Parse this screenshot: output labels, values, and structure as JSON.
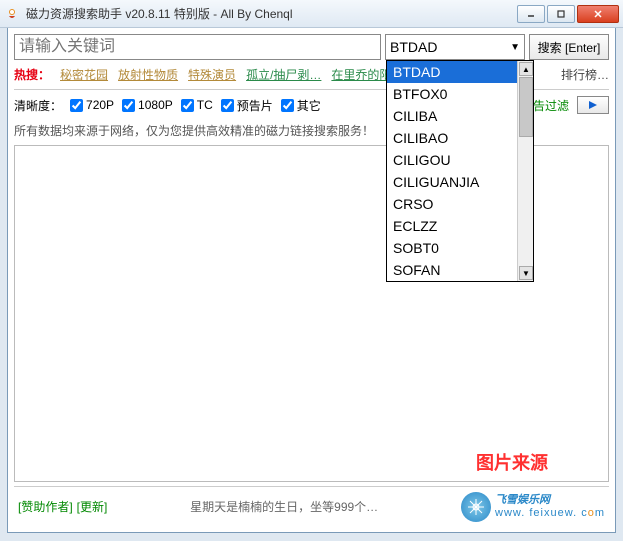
{
  "window": {
    "title": "磁力资源搜索助手 v20.8.11 特别版 - All By Chenql"
  },
  "search": {
    "placeholder": "请输入关键词",
    "source_selected": "BTDAD",
    "button": "搜索 [Enter]"
  },
  "dropdown_options": [
    "BTDAD",
    "BTFOX0",
    "CILIBA",
    "CILIBAO",
    "CILIGOU",
    "CILIGUANJIA",
    "CRSO",
    "ECLZZ",
    "SOBT0",
    "SOFAN"
  ],
  "hot": {
    "label": "热搜：",
    "links": [
      "秘密花园",
      "放射性物质",
      "特殊演员",
      "孤立/抽尸剥…",
      "在里乔的阳…"
    ],
    "rank": "排行榜…"
  },
  "filters": {
    "label": "清晰度：",
    "items": [
      "720P",
      "1080P",
      "TC",
      "预告片",
      "其它"
    ],
    "ad_filter": "广告过滤"
  },
  "info": "所有数据均来源于网络，仅为您提供高效精准的磁力链接搜索服务！",
  "watermark": "图片来源",
  "footer": {
    "sponsor": "[赞助作者]",
    "update": "[更新]",
    "status": "星期天是楠楠的生日，坐等999个…",
    "brand_name": "飞雪娱乐网",
    "brand_url_parts": [
      "www",
      "feixuew",
      "c",
      "m"
    ]
  }
}
